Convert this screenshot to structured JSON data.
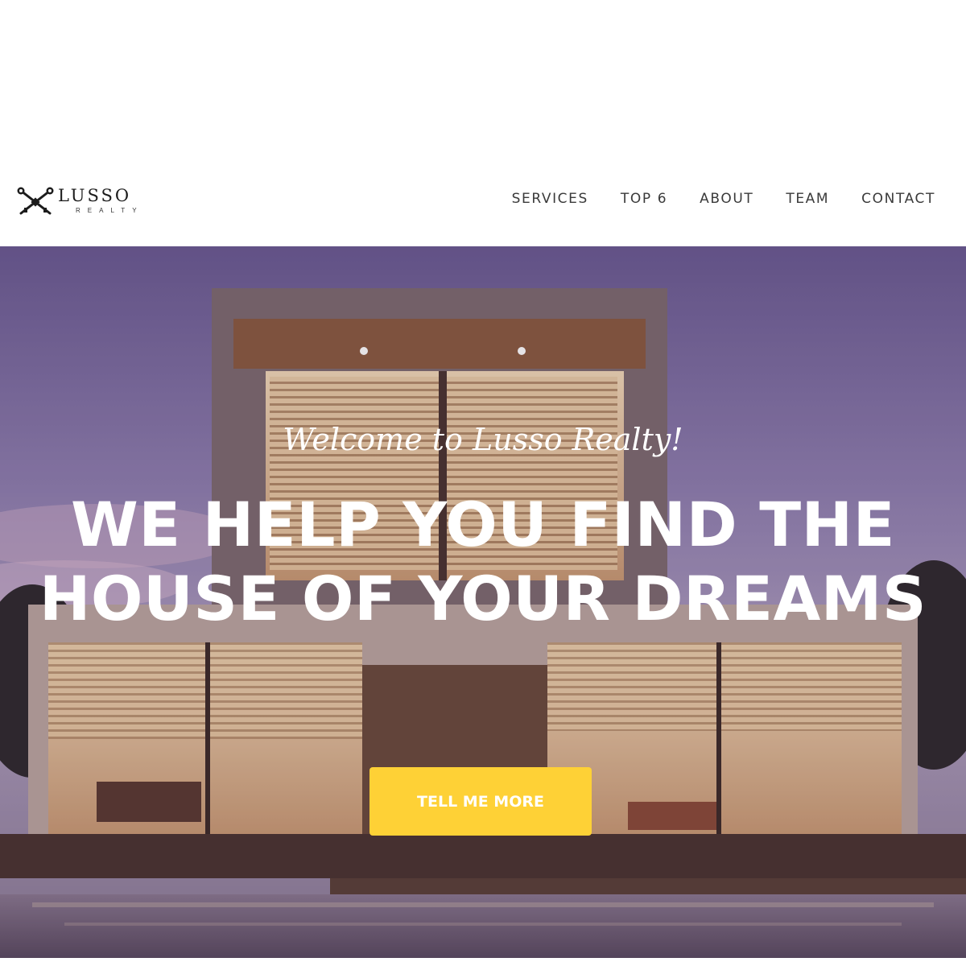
{
  "brand": {
    "name": "LUSSO",
    "subtitle": "REALTY",
    "logo_icon": "crossed-keys-icon"
  },
  "nav": {
    "items": [
      {
        "label": "SERVICES"
      },
      {
        "label": "TOP 6"
      },
      {
        "label": "ABOUT"
      },
      {
        "label": "TEAM"
      },
      {
        "label": "CONTACT"
      }
    ]
  },
  "hero": {
    "welcome": "Welcome to Lusso Realty!",
    "headline": "WE HELP YOU FIND THE HOUSE OF YOUR DREAMS",
    "cta_label": "TELL ME MORE",
    "cta_color": "#fed136"
  }
}
